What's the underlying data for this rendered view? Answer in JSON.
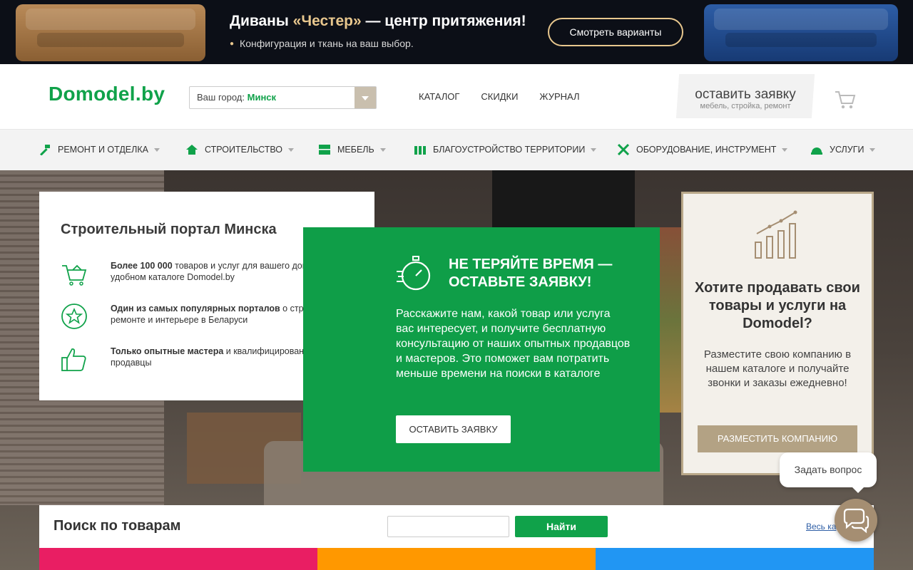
{
  "promo": {
    "title_pre": "Диваны ",
    "title_accent": "«Честер»",
    "title_post": " — центр притяжения!",
    "subtitle": "Конфигурация и ткань на ваш выбор.",
    "button": "Смотреть варианты"
  },
  "header": {
    "logo": "Domodel.by",
    "city_label": "Ваш город:",
    "city_value": "Минск",
    "nav": [
      "КАТАЛОГ",
      "СКИДКИ",
      "ЖУРНАЛ"
    ],
    "request_title": "оставить заявку",
    "request_sub": "мебель, стройка, ремонт"
  },
  "categories": [
    {
      "label": "РЕМОНТ И ОТДЕЛКА",
      "icon": "hammer-icon"
    },
    {
      "label": "СТРОИТЕЛЬСТВО",
      "icon": "house-icon"
    },
    {
      "label": "МЕБЕЛЬ",
      "icon": "drawer-icon"
    },
    {
      "label": "БЛАГОУСТРОЙСТВО ТЕРРИТОРИИ",
      "icon": "fence-icon"
    },
    {
      "label": "ОБОРУДОВАНИЕ, ИНСТРУМЕНТ",
      "icon": "tools-icon"
    },
    {
      "label": "УСЛУГИ",
      "icon": "helmet-icon"
    }
  ],
  "info": {
    "title": "Строительный портал Минска",
    "features": [
      {
        "bold": "Более 100 000",
        "text": " товаров и услуг для вашего дома в удобном каталоге Domodel.by"
      },
      {
        "bold": "Один из самых популярных порталов",
        "text": " о строительстве, ремонте и интерьере в Беларуси"
      },
      {
        "bold": "Только опытные мастера",
        "text": " и квалифицированные продавцы"
      }
    ]
  },
  "cta": {
    "title": "НЕ ТЕРЯЙТЕ ВРЕМЯ — ОСТАВЬТЕ ЗАЯВКУ!",
    "body": "Расскажите нам, какой товар или услуга вас интересует, и получите бесплатную консультацию от наших опытных продавцов и мастеров. Это поможет вам потратить меньше времени на поиски в каталоге",
    "button": "ОСТАВИТЬ ЗАЯВКУ"
  },
  "sell": {
    "title": "Хотите продавать свои товары и услуги на Domodel?",
    "text": "Разместите свою компанию в нашем каталоге и получайте звонки и заказы ежедневно!",
    "button": "РАЗМЕСТИТЬ КОМПАНИЮ"
  },
  "search": {
    "title": "Поиск по товарам",
    "input_value": "",
    "button": "Найти",
    "all_link": "Весь ка"
  },
  "chat": {
    "bubble": "Задать вопрос"
  },
  "colors": {
    "brand_green": "#10a24a",
    "cta_green": "#0f9e48",
    "gold": "#e8c78e",
    "tan": "#b3a284",
    "strip": [
      "#e91e63",
      "#ff9800",
      "#2196f3"
    ]
  }
}
